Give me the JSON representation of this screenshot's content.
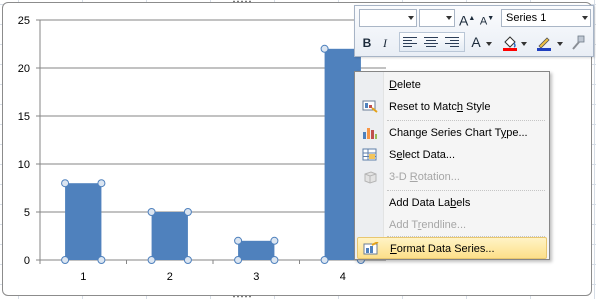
{
  "chart_data": {
    "type": "bar",
    "categories": [
      "1",
      "2",
      "3",
      "4"
    ],
    "values": [
      8,
      5,
      2,
      22
    ],
    "ylim": [
      0,
      25
    ],
    "yticks": [
      "0",
      "5",
      "10",
      "15",
      "20",
      "25"
    ],
    "grid": true,
    "title": "",
    "xlabel": "",
    "ylabel": "",
    "bar_color": "#4f81bd",
    "selected_series": true
  },
  "minibar": {
    "series_select": "Series 1",
    "bold": "B",
    "italic": "I",
    "font_color_glyph": "A",
    "grow_font": "A",
    "shrink_font": "A"
  },
  "context_menu": {
    "items": [
      {
        "pre": "",
        "u": "D",
        "post": "elete",
        "icon": "none",
        "enabled": true
      },
      {
        "pre": "Reset to Matc",
        "u": "h",
        "post": " Style",
        "icon": "reset-style-icon",
        "enabled": true
      },
      {
        "pre": "Change Series Chart T",
        "u": "y",
        "post": "pe...",
        "icon": "chart-type-icon",
        "enabled": true
      },
      {
        "pre": "S",
        "u": "e",
        "post": "lect Data...",
        "icon": "select-data-icon",
        "enabled": true
      },
      {
        "pre": "3-D ",
        "u": "R",
        "post": "otation...",
        "icon": "rotation-icon",
        "enabled": false
      },
      {
        "pre": "Add Data La",
        "u": "b",
        "post": "els",
        "icon": "none",
        "enabled": true
      },
      {
        "pre": "Add T",
        "u": "r",
        "post": "endline...",
        "icon": "none",
        "enabled": false
      },
      {
        "pre": "",
        "u": "F",
        "post": "ormat Data Series...",
        "icon": "format-series-icon",
        "enabled": true,
        "highlighted": true
      }
    ]
  },
  "colors": {
    "menu_highlight": "#fde08a",
    "font_color_bar": "#c00000",
    "fill_color_bar": "#ffff00"
  }
}
